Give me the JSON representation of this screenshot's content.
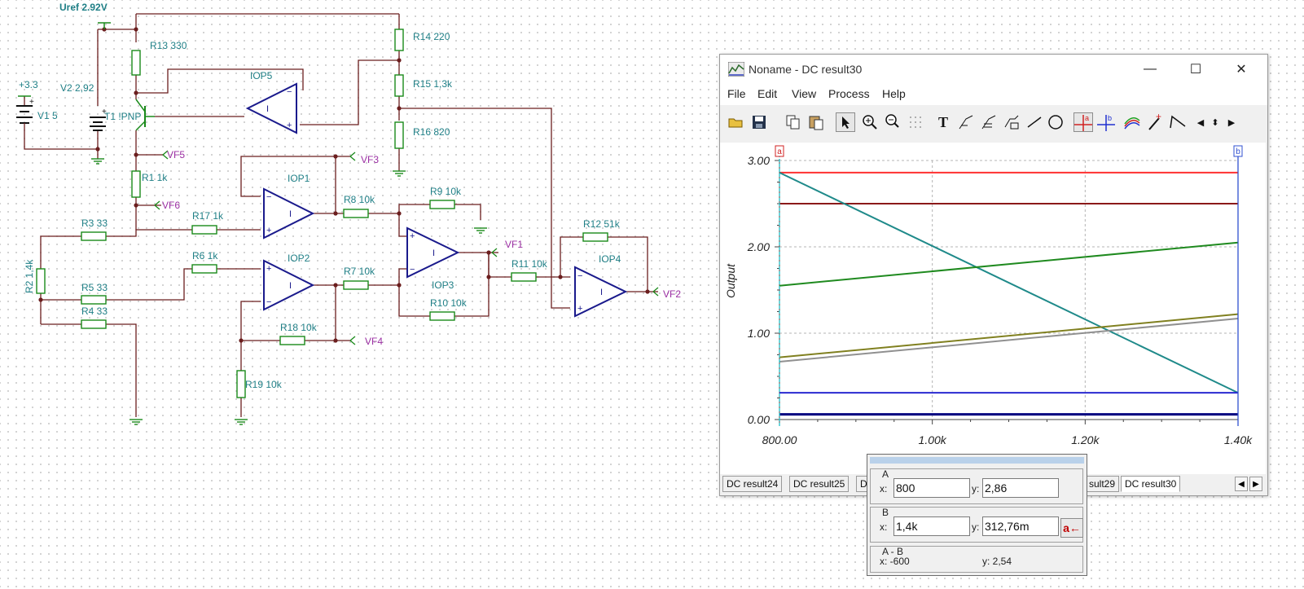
{
  "schematic": {
    "uref_label": "Uref 2.92V",
    "plus33_label": "+3.3",
    "v1_label": "V1 5",
    "v2_label": "V2 2,92",
    "t1_label": "T1 !PNP",
    "resistors": {
      "r13": "R13 330",
      "r14": "R14 220",
      "r15": "R15 1,3k",
      "r16": "R16 820",
      "r1": "R1 1k",
      "r17": "R17 1k",
      "r3": "R3 33",
      "r2": "R2 1,4k",
      "r5": "R5 33",
      "r4": "R4 33",
      "r6": "R6 1k",
      "r8": "R8 10k",
      "r9": "R9 10k",
      "r7": "R7 10k",
      "r18": "R18 10k",
      "r19": "R19 10k",
      "r10": "R10 10k",
      "r11": "R11 10k",
      "r12": "R12 51k"
    },
    "opamps": {
      "iop1": "IOP1",
      "iop2": "IOP2",
      "iop3": "IOP3",
      "iop4": "IOP4",
      "iop5": "IOP5"
    },
    "probes": {
      "vf1": "VF1",
      "vf2": "VF2",
      "vf3": "VF3",
      "vf4": "VF4",
      "vf5": "VF5",
      "vf6": "VF6"
    }
  },
  "window": {
    "title": "Noname - DC result30",
    "controls": {
      "minimize": "—",
      "maximize": "☐",
      "close": "✕"
    },
    "menu": [
      "File",
      "Edit",
      "View",
      "Process",
      "Help"
    ],
    "tabs": [
      "DC result24",
      "DC result25",
      "D",
      "sult29",
      "DC result30"
    ],
    "active_tab": "DC result30"
  },
  "chart_data": {
    "type": "line",
    "ylabel": "Output",
    "xlim": [
      800,
      1400
    ],
    "ylim": [
      0,
      3
    ],
    "x_ticks": [
      "800.00",
      "1.00k",
      "1.20k",
      "1.40k"
    ],
    "y_ticks": [
      "0.00",
      "1.00",
      "2.00",
      "3.00"
    ],
    "grid": true,
    "cursor_a_label": "a",
    "cursor_b_label": "b",
    "series": [
      {
        "color": "#ff3030",
        "x": [
          800,
          1400
        ],
        "y": [
          2.86,
          2.86
        ]
      },
      {
        "color": "#8b1a1a",
        "x": [
          800,
          1400
        ],
        "y": [
          2.5,
          2.5
        ]
      },
      {
        "color": "#1f8a8a",
        "x": [
          800,
          1400
        ],
        "y": [
          2.86,
          0.31
        ]
      },
      {
        "color": "#1f8a1f",
        "x": [
          800,
          1400
        ],
        "y": [
          1.55,
          2.05
        ]
      },
      {
        "color": "#808020",
        "x": [
          800,
          1400
        ],
        "y": [
          0.72,
          1.22
        ]
      },
      {
        "color": "#909090",
        "x": [
          800,
          1400
        ],
        "y": [
          0.67,
          1.17
        ]
      },
      {
        "color": "#2a2ad0",
        "x": [
          800,
          1400
        ],
        "y": [
          0.31,
          0.31
        ]
      },
      {
        "color": "#000080",
        "x": [
          800,
          1400
        ],
        "y": [
          0.06,
          0.06
        ]
      }
    ]
  },
  "cursors": {
    "a": {
      "label": "A",
      "x_label": "x:",
      "x": "800",
      "y_label": "y:",
      "y": "2,86"
    },
    "b": {
      "label": "B",
      "x_label": "x:",
      "x": "1,4k",
      "y_label": "y:",
      "y": "312,76m",
      "swap_icon": "a←"
    },
    "diff": {
      "label": "A - B",
      "x_text": "x:  -600",
      "y_text": "y: 2,54"
    }
  }
}
